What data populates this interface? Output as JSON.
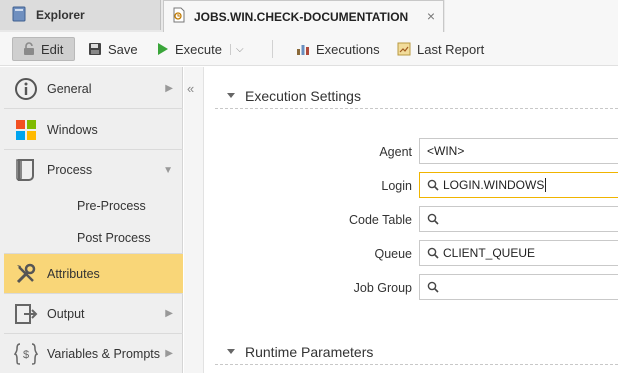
{
  "tabs": {
    "explorer": "Explorer",
    "job": "JOBS.WIN.CHECK-DOCUMENTATION",
    "close": "×"
  },
  "toolbar": {
    "edit": "Edit",
    "save": "Save",
    "execute": "Execute",
    "executions": "Executions",
    "last_report": "Last Report"
  },
  "sidebar": {
    "items": [
      {
        "label": "General",
        "icon": "info-icon"
      },
      {
        "label": "Windows",
        "icon": "windows-logo-icon"
      },
      {
        "label": "Process",
        "icon": "process-icon"
      },
      {
        "label": "Pre-Process"
      },
      {
        "label": "Post Process"
      },
      {
        "label": "Attributes",
        "icon": "wrench-screwdriver-icon"
      },
      {
        "label": "Output",
        "icon": "output-icon"
      },
      {
        "label": "Variables & Prompts",
        "icon": "variables-icon"
      }
    ],
    "active": "Attributes",
    "active_color": "#f9d678",
    "collapse_glyph": "«"
  },
  "main": {
    "execution_settings": "Execution Settings",
    "fields": [
      {
        "label": "Agent",
        "value": "<WIN>"
      },
      {
        "label": "Login",
        "value": "LOGIN.WINDOWS"
      },
      {
        "label": "Code Table",
        "value": ""
      },
      {
        "label": "Queue",
        "value": "CLIENT_QUEUE"
      },
      {
        "label": "Job Group",
        "value": ""
      }
    ],
    "runtime_parameters": "Runtime Parameters"
  }
}
